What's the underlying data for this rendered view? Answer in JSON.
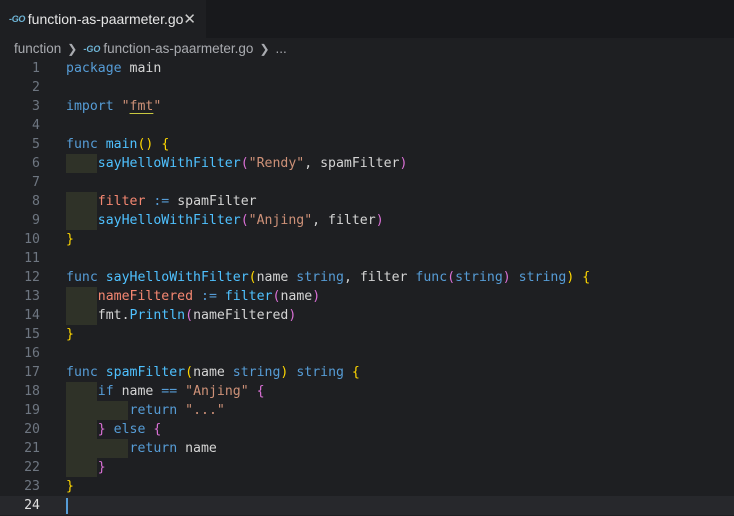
{
  "tab": {
    "icon": "go-file-icon",
    "label": "function-as-paarmeter.go"
  },
  "breadcrumb": {
    "folder": "function",
    "file": "function-as-paarmeter.go",
    "more": "..."
  },
  "code": [
    {
      "n": "1",
      "tokens": [
        [
          "k",
          "package"
        ],
        [
          "pl",
          " main"
        ]
      ]
    },
    {
      "n": "2",
      "tokens": []
    },
    {
      "n": "3",
      "tokens": [
        [
          "k",
          "import"
        ],
        [
          "pl",
          " "
        ],
        [
          "s",
          "\""
        ],
        [
          "imp",
          "fmt"
        ],
        [
          "s",
          "\""
        ]
      ]
    },
    {
      "n": "4",
      "tokens": []
    },
    {
      "n": "5",
      "tokens": [
        [
          "k",
          "func"
        ],
        [
          "pl",
          " "
        ],
        [
          "fn",
          "main"
        ],
        [
          "b1",
          "()"
        ],
        [
          "pl",
          " "
        ],
        [
          "b1",
          "{"
        ]
      ]
    },
    {
      "n": "6",
      "indent": 1,
      "tokens": [
        [
          "pl",
          "    "
        ],
        [
          "fn",
          "sayHelloWithFilter"
        ],
        [
          "b2",
          "("
        ],
        [
          "s",
          "\"Rendy\""
        ],
        [
          "pl",
          ", spamFilter"
        ],
        [
          "b2",
          ")"
        ]
      ]
    },
    {
      "n": "7",
      "tokens": []
    },
    {
      "n": "8",
      "indent": 1,
      "tokens": [
        [
          "pl",
          "    "
        ],
        [
          "v",
          "filter"
        ],
        [
          "pl",
          " "
        ],
        [
          "k",
          ":="
        ],
        [
          "pl",
          " spamFilter"
        ]
      ]
    },
    {
      "n": "9",
      "indent": 1,
      "tokens": [
        [
          "pl",
          "    "
        ],
        [
          "fn",
          "sayHelloWithFilter"
        ],
        [
          "b2",
          "("
        ],
        [
          "s",
          "\"Anjing\""
        ],
        [
          "pl",
          ", filter"
        ],
        [
          "b2",
          ")"
        ]
      ]
    },
    {
      "n": "10",
      "tokens": [
        [
          "b1",
          "}"
        ]
      ]
    },
    {
      "n": "11",
      "tokens": []
    },
    {
      "n": "12",
      "tokens": [
        [
          "k",
          "func"
        ],
        [
          "pl",
          " "
        ],
        [
          "fn",
          "sayHelloWithFilter"
        ],
        [
          "b1",
          "("
        ],
        [
          "pl",
          "name "
        ],
        [
          "ty",
          "string"
        ],
        [
          "pl",
          ", filter "
        ],
        [
          "k",
          "func"
        ],
        [
          "b2",
          "("
        ],
        [
          "ty",
          "string"
        ],
        [
          "b2",
          ")"
        ],
        [
          "pl",
          " "
        ],
        [
          "ty",
          "string"
        ],
        [
          "b1",
          ")"
        ],
        [
          "pl",
          " "
        ],
        [
          "b1",
          "{"
        ]
      ]
    },
    {
      "n": "13",
      "indent": 1,
      "tokens": [
        [
          "pl",
          "    "
        ],
        [
          "v",
          "nameFiltered"
        ],
        [
          "pl",
          " "
        ],
        [
          "k",
          ":="
        ],
        [
          "pl",
          " "
        ],
        [
          "fn",
          "filter"
        ],
        [
          "b2",
          "("
        ],
        [
          "pl",
          "name"
        ],
        [
          "b2",
          ")"
        ]
      ]
    },
    {
      "n": "14",
      "indent": 1,
      "tokens": [
        [
          "pl",
          "    fmt."
        ],
        [
          "fn",
          "Println"
        ],
        [
          "b2",
          "("
        ],
        [
          "pl",
          "nameFiltered"
        ],
        [
          "b2",
          ")"
        ]
      ]
    },
    {
      "n": "15",
      "tokens": [
        [
          "b1",
          "}"
        ]
      ]
    },
    {
      "n": "16",
      "tokens": []
    },
    {
      "n": "17",
      "tokens": [
        [
          "k",
          "func"
        ],
        [
          "pl",
          " "
        ],
        [
          "fn",
          "spamFilter"
        ],
        [
          "b1",
          "("
        ],
        [
          "pl",
          "name "
        ],
        [
          "ty",
          "string"
        ],
        [
          "b1",
          ")"
        ],
        [
          "pl",
          " "
        ],
        [
          "ty",
          "string"
        ],
        [
          "pl",
          " "
        ],
        [
          "b1",
          "{"
        ]
      ]
    },
    {
      "n": "18",
      "indent": 1,
      "tokens": [
        [
          "pl",
          "    "
        ],
        [
          "k",
          "if"
        ],
        [
          "pl",
          " name "
        ],
        [
          "k",
          "=="
        ],
        [
          "pl",
          " "
        ],
        [
          "s",
          "\"Anjing\""
        ],
        [
          "pl",
          " "
        ],
        [
          "b2",
          "{"
        ]
      ]
    },
    {
      "n": "19",
      "indent": 2,
      "tokens": [
        [
          "pl",
          "        "
        ],
        [
          "k",
          "return"
        ],
        [
          "pl",
          " "
        ],
        [
          "s",
          "\"...\""
        ]
      ]
    },
    {
      "n": "20",
      "indent": 1,
      "tokens": [
        [
          "pl",
          "    "
        ],
        [
          "b2",
          "}"
        ],
        [
          "pl",
          " "
        ],
        [
          "k",
          "else"
        ],
        [
          "pl",
          " "
        ],
        [
          "b2",
          "{"
        ]
      ]
    },
    {
      "n": "21",
      "indent": 2,
      "tokens": [
        [
          "pl",
          "        "
        ],
        [
          "k",
          "return"
        ],
        [
          "pl",
          " name"
        ]
      ]
    },
    {
      "n": "22",
      "indent": 1,
      "tokens": [
        [
          "pl",
          "    "
        ],
        [
          "b2",
          "}"
        ]
      ]
    },
    {
      "n": "23",
      "tokens": [
        [
          "b1",
          "}"
        ]
      ]
    },
    {
      "n": "24",
      "current": true,
      "tokens": []
    }
  ]
}
